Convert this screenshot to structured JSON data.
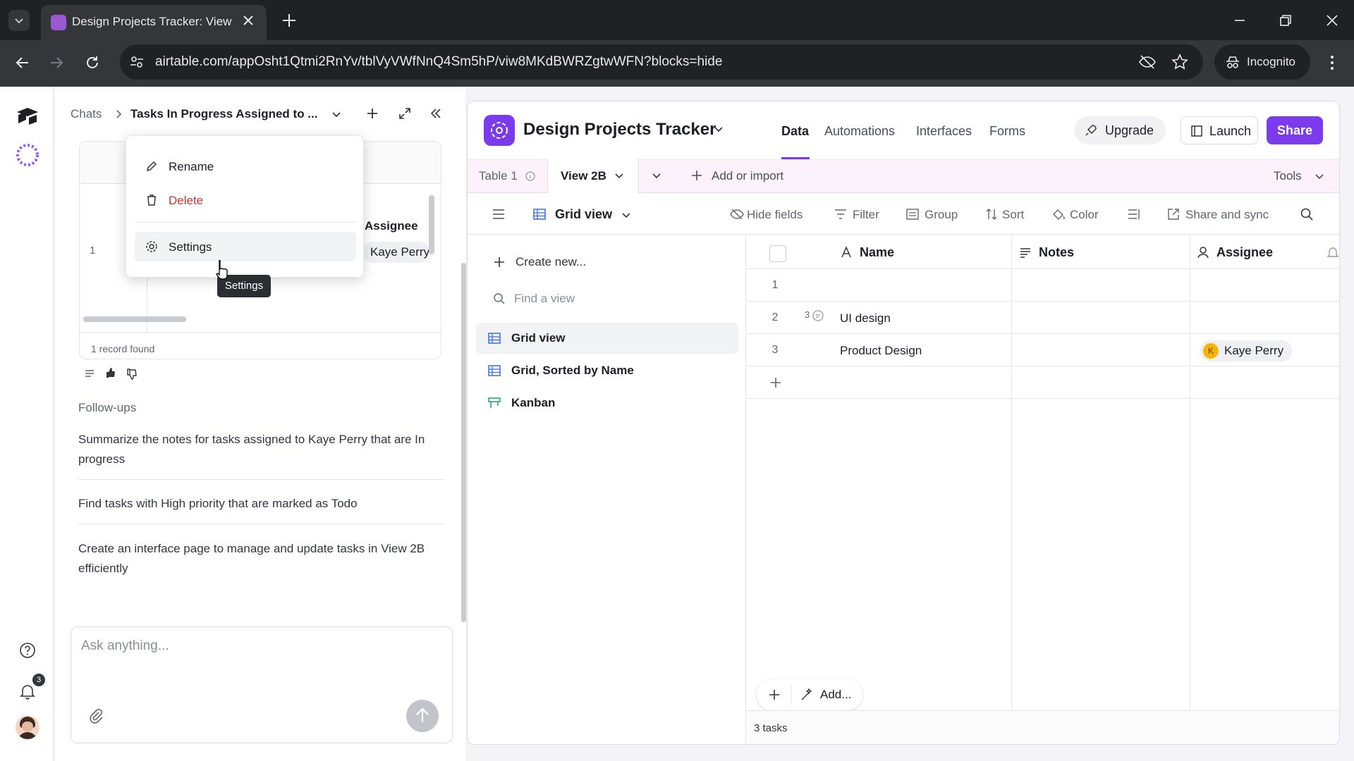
{
  "browser": {
    "tab_title": "Design Projects Tracker: View 2B",
    "url": "airtable.com/appOsht1Qtmi2RnYv/tblVyVWfNnQ4Sm5hP/viw8MKdBWRZgtwWFN?blocks=hide",
    "incognito_label": "Incognito"
  },
  "rail": {
    "notification_count": "3"
  },
  "chat": {
    "breadcrumb_root": "Chats",
    "chat_title": "Tasks In Progress Assigned to ...",
    "preview_col_header": "Assignee",
    "preview_row_num": "1",
    "preview_assignee": "Kaye Perry",
    "records_found": "1 record found",
    "followups_label": "Follow-ups",
    "followups": [
      "Summarize the notes for tasks assigned to Kaye Perry that are In progress",
      "Find tasks with High priority that are marked as Todo",
      "Create an interface page to manage and update tasks in View 2B efficiently"
    ],
    "input_placeholder": "Ask anything...",
    "menu": {
      "rename": "Rename",
      "delete": "Delete",
      "settings": "Settings"
    },
    "tooltip": "Settings"
  },
  "base": {
    "name": "Design Projects Tracker",
    "nav": [
      "Data",
      "Automations",
      "Interfaces",
      "Forms"
    ],
    "active_nav": "Data",
    "upgrade": "Upgrade",
    "launch": "Launch",
    "share": "Share",
    "accent": "#7c3aed",
    "danger": "#c0392b"
  },
  "tables": {
    "table1": "Table 1",
    "view2b": "View 2B",
    "add_import": "Add or import",
    "tools": "Tools"
  },
  "viewbar": {
    "view_name": "Grid view",
    "hide_fields": "Hide fields",
    "filter": "Filter",
    "group": "Group",
    "sort": "Sort",
    "color": "Color",
    "share_sync": "Share and sync"
  },
  "sidebar": {
    "create_new": "Create new...",
    "find_placeholder": "Find a view",
    "views": [
      "Grid view",
      "Grid, Sorted by Name",
      "Kanban"
    ]
  },
  "grid": {
    "columns": [
      "Name",
      "Notes",
      "Assignee"
    ],
    "rows": [
      {
        "num": "1",
        "name": "",
        "notes": "",
        "assignee": "",
        "comments": ""
      },
      {
        "num": "2",
        "name": "UI design",
        "notes": "",
        "assignee": "",
        "comments": "3"
      },
      {
        "num": "3",
        "name": "Product Design",
        "notes": "",
        "assignee": "Kaye Perry",
        "comments": ""
      }
    ],
    "assignee_initial": "K",
    "add_label": "Add...",
    "count": "3 tasks"
  }
}
